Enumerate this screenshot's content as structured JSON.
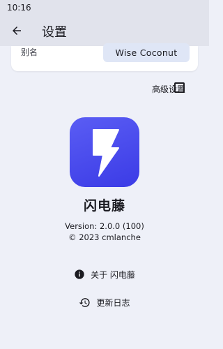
{
  "status_bar": {
    "time": "10:16"
  },
  "app_bar": {
    "title": "设置",
    "back_icon": "arrow-back-icon"
  },
  "settings": {
    "alias_label": "别名",
    "alias_value": "Wise Coconut",
    "advanced_label": "高级设置",
    "advanced_checked": false
  },
  "about": {
    "app_name": "闪电藤",
    "version": "Version: 2.0.0 (100)",
    "copyright": "© 2023 cmlanche",
    "about_link": "关于 闪电藤",
    "changelog_link": "更新日志"
  },
  "colors": {
    "background": "#eef0f8",
    "app_bar": "#e1e3ec",
    "icon_gradient_start": "#5a5df4",
    "icon_gradient_end": "#3b3be6",
    "alias_field_bg": "#dfe6f6"
  },
  "icons": [
    "arrow-back-icon",
    "lightning-bolt-icon",
    "info-icon",
    "history-icon"
  ]
}
